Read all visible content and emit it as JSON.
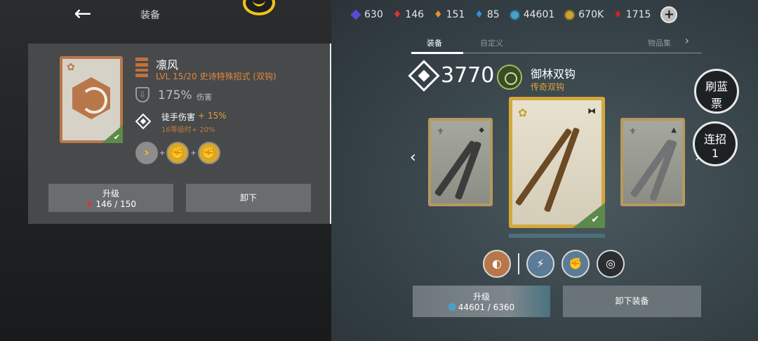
{
  "header": {
    "title": "装备",
    "back_icon": "←"
  },
  "currencies": [
    {
      "icon": "purple-diamond-icon",
      "value": "630"
    },
    {
      "icon": "red-crystal-icon",
      "value": "146"
    },
    {
      "icon": "orange-crystal-icon",
      "value": "151"
    },
    {
      "icon": "blue-crystal-icon",
      "value": "85"
    },
    {
      "icon": "swirl-token-icon",
      "value": "44601"
    },
    {
      "icon": "gold-coin-icon",
      "value": "670K"
    },
    {
      "icon": "red-gem-icon",
      "value": "1715"
    }
  ],
  "add_currency_label": "+",
  "skill_detail": {
    "name": "凛风",
    "level_line": "LVL  15/20  史诗特殊招式 (双钩)",
    "damage_value": "175%",
    "damage_label": "伤害",
    "bonus_name": "徒手伤害",
    "bonus_value": "+ 15%",
    "bonus_sub": "16等级时+ 20%",
    "combo_plus": "+",
    "upgrade_label": "升级",
    "upgrade_cost": "146 / 150",
    "unload_label": "卸下"
  },
  "tabs": [
    {
      "label": "装备",
      "active": true
    },
    {
      "label": "自定义",
      "active": false
    },
    {
      "label": "物品集",
      "active": false
    }
  ],
  "tab_next": "›",
  "weapon": {
    "power": "3770",
    "name": "御林双钩",
    "rarity": "传奇双钩"
  },
  "side_buttons": {
    "refresh_line1": "刷蓝",
    "refresh_line2": "票",
    "combo_line1": "连招",
    "combo_line2": "1"
  },
  "nav": {
    "prev": "‹",
    "next": "›"
  },
  "actions": {
    "upgrade_label": "升级",
    "upgrade_cost": "44601 / 6360",
    "unequip_label": "卸下装备"
  },
  "colors": {
    "accent_gold": "#d4a83a",
    "rarity_orange": "#e0a13a",
    "epic_bronze": "#b8774a",
    "equipped_green": "#5c8a4a"
  }
}
